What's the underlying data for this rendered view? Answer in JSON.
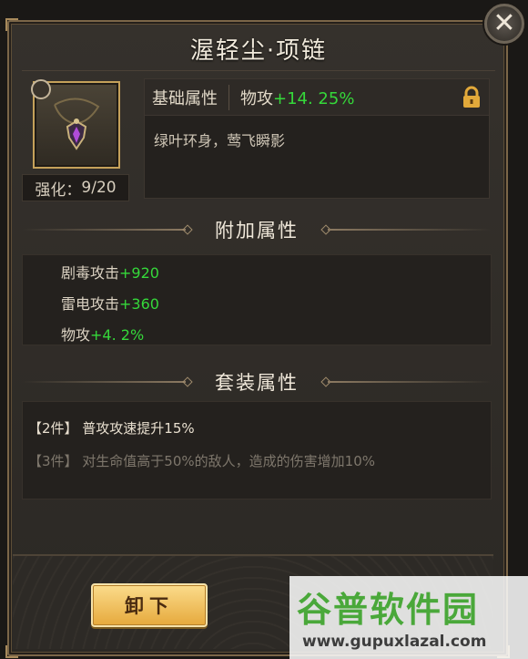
{
  "window": {
    "title": "渥轻尘·项链",
    "close_glyph": "✕"
  },
  "item": {
    "icon": "necklace-icon",
    "enhance_label": "强化：",
    "enhance_value": "9/20"
  },
  "base_attributes": {
    "label": "基础属性",
    "stat_name": "物攻",
    "stat_value": "+14. 25%",
    "lock_icon": "lock-icon",
    "flavor_text": "绿叶环身，莺飞瞬影"
  },
  "additional_attributes": {
    "heading": "附加属性",
    "items": [
      {
        "name": "剧毒攻击",
        "value": "+920"
      },
      {
        "name": "雷电攻击",
        "value": "+360"
      },
      {
        "name": "物攻",
        "value": "+4. 2%"
      }
    ]
  },
  "set_attributes": {
    "heading": "套装属性",
    "items": [
      {
        "text": "【2件】 普攻攻速提升15%",
        "active": true
      },
      {
        "text": "【3件】 对生命值高于50%的敌人，造成的伤害增加10%",
        "active": false
      }
    ]
  },
  "actions": {
    "unequip_label": "卸下"
  },
  "watermark": {
    "title": "谷普软件园",
    "url": "www.gupuxlazal.com"
  },
  "colors": {
    "stat_green": "#35d83a",
    "button_gold": "#e6a93c",
    "frame_gold": "#c5a15a",
    "panel_bg": "#2b2824"
  }
}
